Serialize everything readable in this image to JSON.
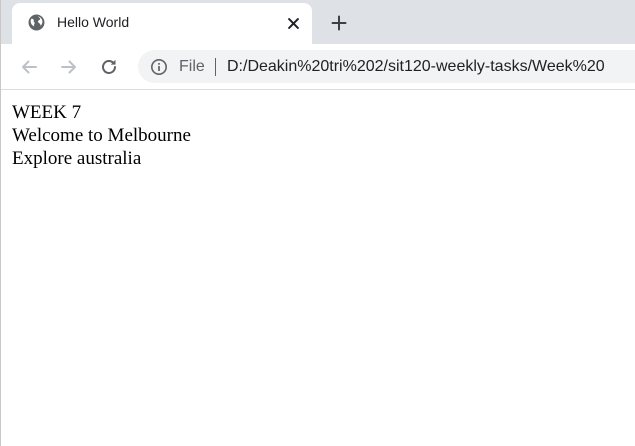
{
  "browser": {
    "tab": {
      "title": "Hello World",
      "favicon_icon": "globe-icon",
      "close_icon": "close-icon"
    },
    "new_tab_icon": "plus-icon",
    "toolbar": {
      "back_icon": "back-arrow-icon",
      "forward_icon": "forward-arrow-icon",
      "reload_icon": "reload-icon",
      "info_icon": "info-icon",
      "scheme_label": "File",
      "url": "D:/Deakin%20tri%202/sit120-weekly-tasks/Week%20"
    }
  },
  "page": {
    "lines": [
      "WEEK 7",
      "Welcome to Melbourne",
      "Explore australia"
    ]
  },
  "colors": {
    "tabstrip_bg": "#dee1e6",
    "omnibox_bg": "#f1f3f4",
    "icon_gray": "#5f6368",
    "disabled_icon": "#bdc1c6",
    "text_dark": "#202124"
  }
}
